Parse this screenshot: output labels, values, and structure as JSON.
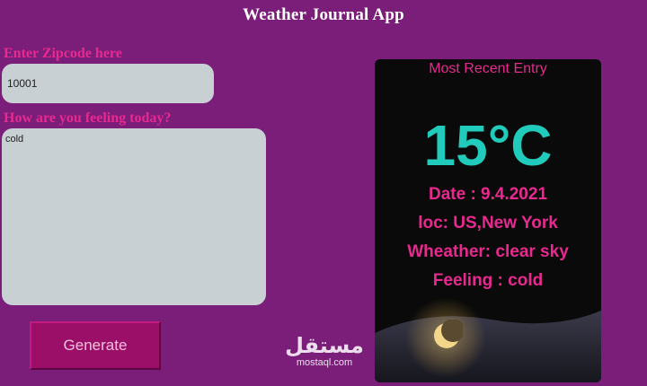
{
  "app": {
    "title": "Weather Journal App"
  },
  "form": {
    "zip_label": "Enter Zipcode here",
    "zip_value": "10001",
    "feeling_label": "How are you feeling today?",
    "feeling_value": "cold",
    "generate_label": "Generate"
  },
  "entry": {
    "title": "Most Recent Entry",
    "temp": "15°C",
    "date": "Date : 9.4.2021",
    "location": "loc: US,New York",
    "weather": "Wheather: clear sky",
    "feeling": "Feeling : cold",
    "icon": "moon-icon"
  },
  "watermark": {
    "arabic": "مستقل",
    "latin": "mostaql.com"
  },
  "colors": {
    "background": "#7b1e7a",
    "accent_pink": "#e8298f",
    "temp_teal": "#21cbbb",
    "input_gray": "#c9d0d3",
    "card_black": "#0a0a0a"
  }
}
